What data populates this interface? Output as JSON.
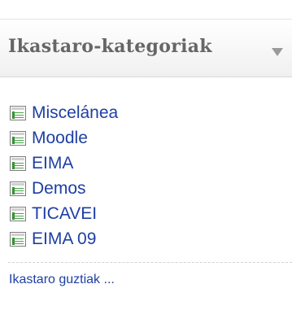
{
  "block": {
    "title": "Ikastaro-kategoriak",
    "collapse_icon": "chevron-down-icon"
  },
  "categories": [
    {
      "label": "Miscelánea",
      "icon": "category-icon"
    },
    {
      "label": "Moodle",
      "icon": "category-icon"
    },
    {
      "label": "EIMA",
      "icon": "category-icon"
    },
    {
      "label": "Demos",
      "icon": "category-icon"
    },
    {
      "label": "TICAVEI",
      "icon": "category-icon"
    },
    {
      "label": "EIMA 09",
      "icon": "category-icon"
    }
  ],
  "footer": {
    "all_courses_label": "Ikastaro guztiak ..."
  },
  "colors": {
    "title": "#666666",
    "link": "#1e3fa3",
    "icon_green": "#47a347"
  }
}
